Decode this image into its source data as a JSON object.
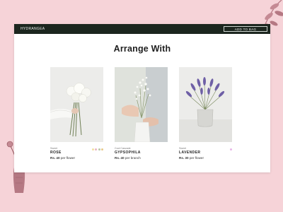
{
  "header": {
    "brand": "HYDRANGEA",
    "bag_button": "ADD TO BAG"
  },
  "title": "Arrange With",
  "products": [
    {
      "category": "Sweet",
      "name": "ROSE",
      "price_prefix": "Rs. 40",
      "price_unit": "per flower",
      "image": "white-roses-bouquet",
      "swatches": [
        "#f2e1a0",
        "#e9b4c4",
        "#b9c8a8",
        "#e8c98a"
      ]
    },
    {
      "category": "Cool Cascade",
      "name": "GYPSOPHILA",
      "price_prefix": "Rs. 40",
      "price_unit": "per branch",
      "image": "gypsophila-in-vase",
      "swatches": []
    },
    {
      "category": "Sweet",
      "name": "LAVENDER",
      "price_prefix": "Rs. 30",
      "price_unit": "per flower",
      "image": "lavender-in-pot",
      "swatches": [
        "#e7b6e8"
      ]
    }
  ],
  "colors": {
    "topbar": "#1c261f",
    "background": "#f6d3d8",
    "accent": "#b57883"
  }
}
